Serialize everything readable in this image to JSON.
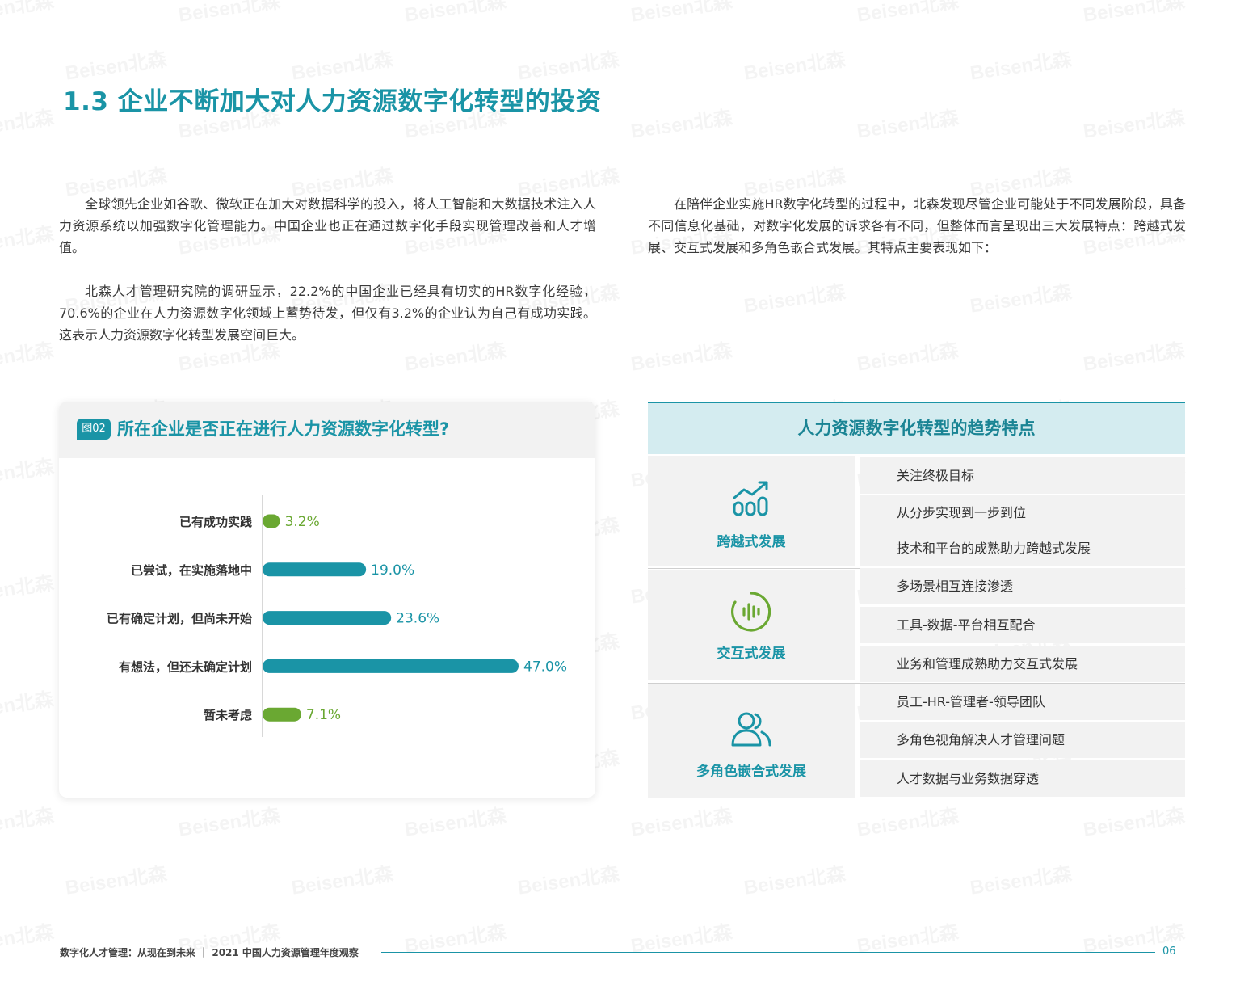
{
  "title": "1.3 企业不断加大对人力资源数字化转型的投资",
  "paragraphs": {
    "left_1": "全球领先企业如谷歌、微软正在加大对数据科学的投入，将人工智能和大数据技术注入人力资源系统以加强数字化管理能力。中国企业也正在通过数字化手段实现管理改善和人才增值。",
    "left_2": "北森人才管理研究院的调研显示，22.2%的中国企业已经具有切实的HR数字化经验，70.6%的企业在人力资源数字化领域上蓄势待发，但仅有3.2%的企业认为自己有成功实践。这表示人力资源数字化转型发展空间巨大。",
    "right_1": "在陪伴企业实施HR数字化转型的过程中，北森发现尽管企业可能处于不同发展阶段，具备不同信息化基础，对数字化发展的诉求各有不同，但整体而言呈现出三大发展特点：跨越式发展、交互式发展和多角色嵌合式发展。其特点主要表现如下："
  },
  "figure": {
    "badge": "图02",
    "title": "所在企业是否正在进行人力资源数字化转型?"
  },
  "chart_data": {
    "type": "bar",
    "orientation": "horizontal",
    "categories": [
      "已有成功实践",
      "已尝试，在实施落地中",
      "已有确定计划，但尚未开始",
      "有想法，但还未确定计划",
      "暂未考虑"
    ],
    "values": [
      3.2,
      19.0,
      23.6,
      47.0,
      7.1
    ],
    "value_labels": [
      "3.2%",
      "19.0%",
      "23.6%",
      "47.0%",
      "7.1%"
    ],
    "colors": [
      "#6aa832",
      "#1a94a6",
      "#1a94a6",
      "#1a94a6",
      "#6aa832"
    ],
    "title": "所在企业是否正在进行人力资源数字化转型?",
    "xlabel": "",
    "ylabel": "",
    "xlim": [
      0,
      50
    ],
    "grid": false,
    "legend": "none"
  },
  "trend_table": {
    "header": "人力资源数字化转型的趋势特点",
    "groups": [
      {
        "label": "跨越式发展",
        "icon": "growth-chart-icon",
        "items": [
          "关注终极目标",
          "从分步实现到一步到位",
          "技术和平台的成熟助力跨越式发展"
        ]
      },
      {
        "label": "交互式发展",
        "icon": "sound-wave-icon",
        "items": [
          "多场景相互连接渗透",
          "工具-数据-平台相互配合",
          "业务和管理成熟助力交互式发展"
        ]
      },
      {
        "label": "多角色嵌合式发展",
        "icon": "users-icon",
        "items": [
          "员工-HR-管理者-领导团队",
          "多角色视角解决人才管理问题",
          "人才数据与业务数据穿透"
        ]
      }
    ]
  },
  "footer": {
    "text": "数字化人才管理：从现在到未来 ｜ 2021 中国人力资源管理年度观察",
    "page": "06"
  },
  "colors": {
    "accent": "#1a94a6",
    "green": "#6aa832",
    "panel": "#f2f2f2",
    "header_bg": "#d4ecf0"
  },
  "watermark": "Beisen北森"
}
